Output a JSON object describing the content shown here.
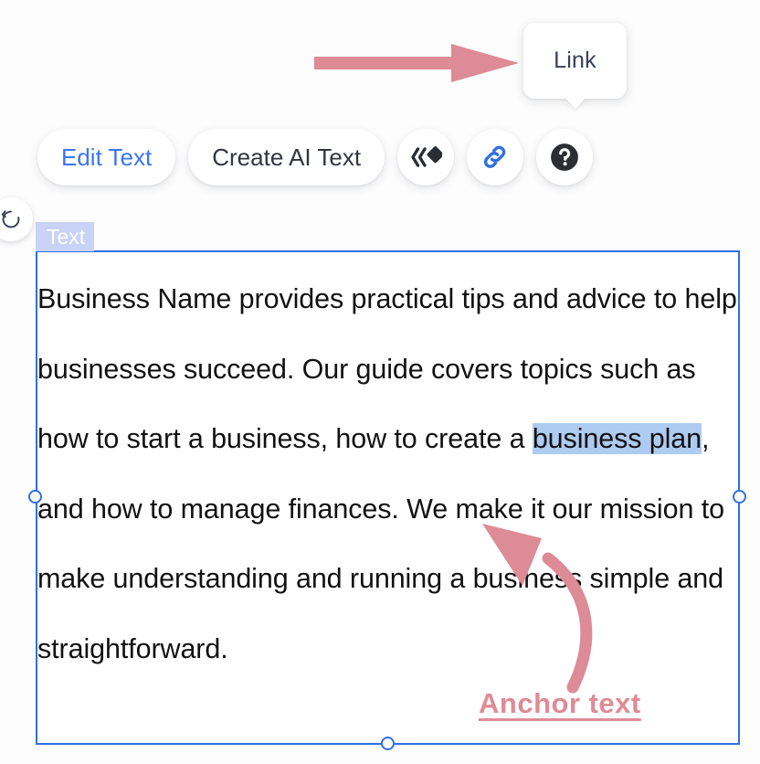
{
  "canvas": {
    "background_color": "#fdfdfd"
  },
  "tooltip": {
    "label": "Link",
    "text_color": "#36405a",
    "background": "#ffffff"
  },
  "annotations": {
    "pointer_arrow": {
      "name": "straight-arrow",
      "color": "#dd8b96",
      "direction": "right"
    },
    "curved_arrow": {
      "name": "curved-arrow",
      "color": "#dd8b96",
      "direction": "up-left"
    },
    "anchor_label": {
      "text": "Anchor text",
      "color": "#df8b97",
      "bold": true,
      "underline": true
    }
  },
  "toolbar": {
    "edit_text_label": "Edit Text",
    "edit_text_color": "#3b76f6",
    "create_ai_text_label": "Create AI Text",
    "create_ai_text_color": "#32363d",
    "icons": [
      {
        "name": "send-backward-icon",
        "glyph": "chevrons-diamond",
        "color": "#2b2f33"
      },
      {
        "name": "link-icon",
        "glyph": "chain-link",
        "color": "#2f6fe4"
      },
      {
        "name": "help-icon",
        "glyph": "question-mark-circle",
        "color": "#2b2f33"
      }
    ]
  },
  "rotate_handle": {
    "name": "rotate-icon",
    "color": "#3a4254"
  },
  "text_element": {
    "type_badge": "Text",
    "badge_background": "#c8d3f6",
    "badge_text_color": "#ffffff",
    "frame_border_color": "#2f6fe4",
    "selection_highlight_color": "#aecbf1",
    "selected_text": "business plan",
    "body_before": "Business Name provides practical tips and advice to help businesses succeed. Our guide covers topics such as how to start a business, how to create a ",
    "body_after": ", and how to manage finances. We make it our mission to make understanding and running a business simple and straightforward.",
    "full_text": "Business Name provides practical tips and advice to help businesses succeed. Our guide covers topics such as how to start a business, how to create a business plan, and how to manage finances. We make it our mission to make understanding and running a business simple and straightforward.",
    "handles": [
      {
        "name": "resize-handle-left"
      },
      {
        "name": "resize-handle-right"
      },
      {
        "name": "resize-handle-bottom"
      }
    ]
  }
}
